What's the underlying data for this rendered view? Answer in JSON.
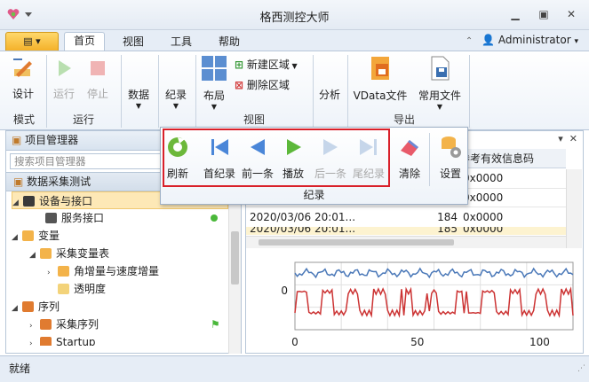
{
  "app": {
    "title": "格西测控大师"
  },
  "tabs": [
    "首页",
    "视图",
    "工具",
    "帮助"
  ],
  "user": {
    "name": "Administrator"
  },
  "ribbon": {
    "groups": {
      "mode": {
        "label": "模式",
        "buttons": [
          "设计"
        ]
      },
      "run": {
        "label": "运行",
        "buttons": [
          "运行",
          "停止"
        ]
      },
      "data": {
        "buttons": [
          "数据",
          "纪录"
        ]
      },
      "view": {
        "label": "视图",
        "buttons": [
          "布局",
          "新建区域",
          "删除区域"
        ]
      },
      "analysis": {
        "buttons": [
          "分析"
        ]
      },
      "export": {
        "label": "导出",
        "buttons": [
          "VData文件",
          "常用文件"
        ]
      }
    }
  },
  "popup": {
    "label": "纪录",
    "buttons": [
      "刷新",
      "首纪录",
      "前一条",
      "播放",
      "后一条",
      "尾纪录",
      "清除",
      "设置"
    ]
  },
  "project": {
    "title": "项目管理器",
    "search_placeholder": "搜索项目管理器",
    "group": "数据采集测试",
    "items": [
      "设备与接口",
      "服务接口",
      "变量",
      "采集变量表",
      "角增量与速度增量",
      "透明度",
      "序列",
      "采集序列",
      "Startup"
    ]
  },
  "grid": {
    "header_partial": "参考有效信息码",
    "rows": [
      {
        "time": "",
        "value": "",
        "code": "0x0000"
      },
      {
        "time": "",
        "value": "",
        "code": "0x0000"
      },
      {
        "time": "2020/03/06 20:01...",
        "value": "184",
        "code": "0x0000"
      },
      {
        "time": "2020/03/06 20:01...",
        "value": "185",
        "code": "0x0000"
      }
    ]
  },
  "chart_data": {
    "type": "line",
    "x_ticks": [
      "0",
      "50",
      "100"
    ],
    "y_ticks": [
      "0"
    ],
    "series": [
      {
        "color": "#4a78b8"
      },
      {
        "color": "#cc3333"
      }
    ]
  },
  "status": {
    "text": "就绪"
  }
}
